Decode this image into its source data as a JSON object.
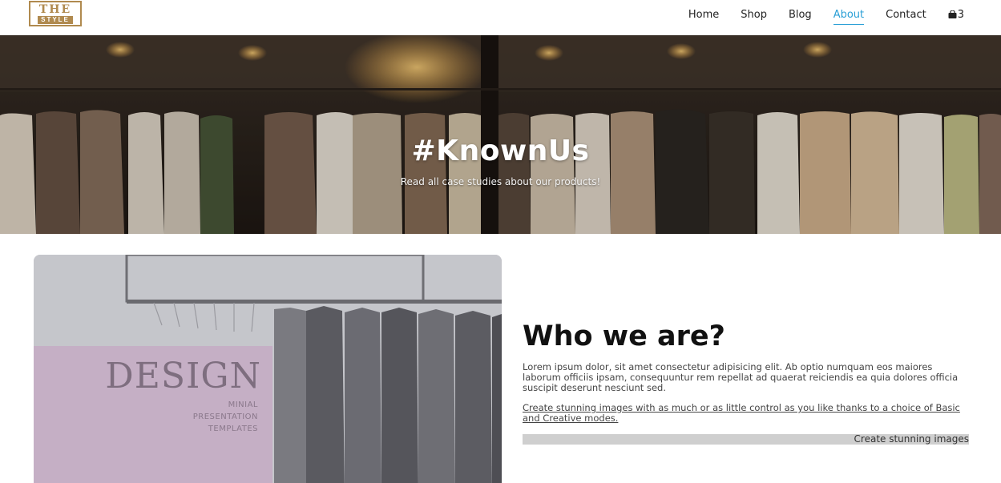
{
  "brand": {
    "logo_top": "THE",
    "logo_bottom": "STYLE",
    "color": "#b08a4f"
  },
  "nav": {
    "items": [
      {
        "label": "Home",
        "active": false
      },
      {
        "label": "Shop",
        "active": false
      },
      {
        "label": "Blog",
        "active": false
      },
      {
        "label": "About",
        "active": true
      },
      {
        "label": "Contact",
        "active": false
      }
    ],
    "cart_icon": "shopping-bag-icon",
    "cart_count": "3",
    "accent": "#2a9fd6"
  },
  "hero": {
    "title": "#KnownUs",
    "subtitle": "Read all case studies about our products!"
  },
  "feature": {
    "design_word": "DESIGN",
    "design_lines": [
      "MINIAL",
      "PRESENTATION",
      "TEMPLATES"
    ]
  },
  "about": {
    "heading": "Who we are?",
    "body": "Lorem ipsum dolor, sit amet consectetur adipisicing elit. Ab optio numquam eos maiores laborum officiis ipsam, consequuntur rem repellat ad quaerat reiciendis ea quia dolores officia suscipit deserunt nesciunt sed.",
    "link": "Create stunning images with as much or as little control as you like thanks to a choice of Basic and Creative modes.",
    "ticker": "Create stunning images"
  }
}
